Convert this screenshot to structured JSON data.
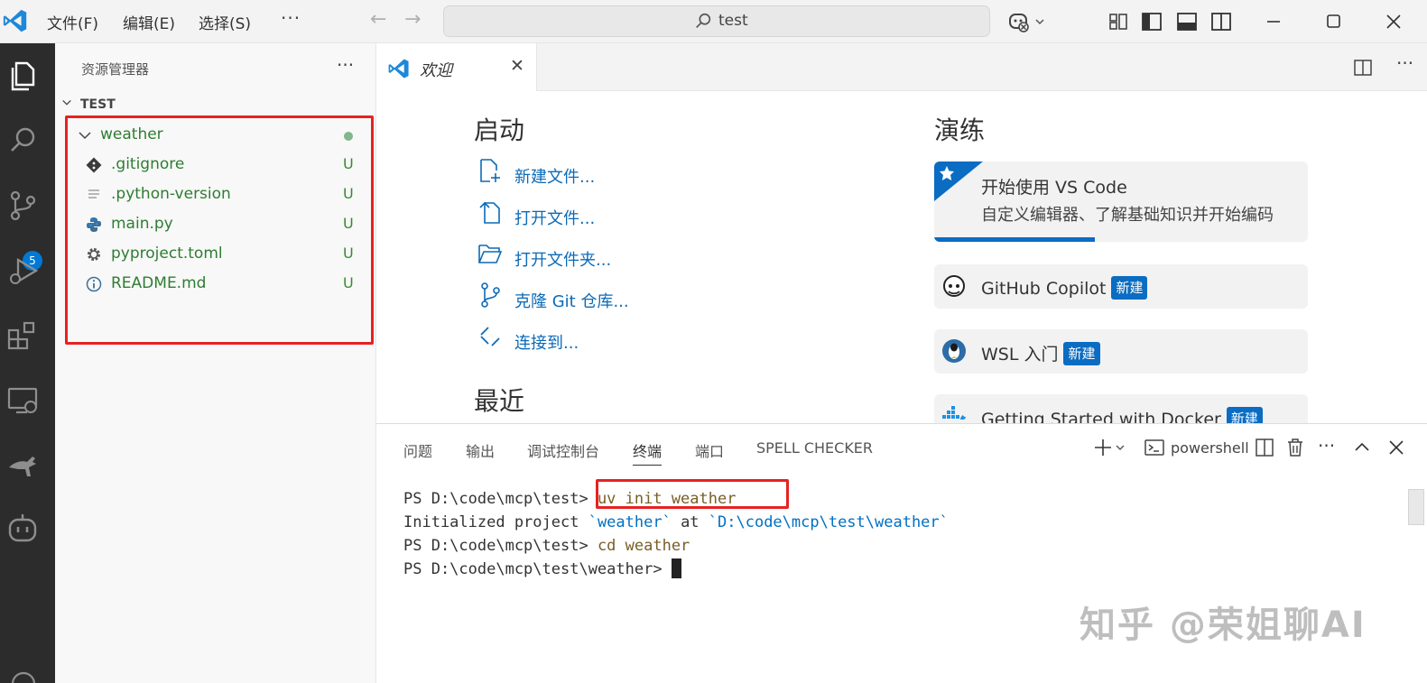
{
  "titlebar": {
    "menu": [
      "文件(F)",
      "编辑(E)",
      "选择(S)"
    ],
    "more": "···",
    "search": "test"
  },
  "activitybar": {
    "icons": [
      "explorer-icon",
      "search-icon",
      "source-control-icon",
      "run-debug-icon",
      "extensions-icon",
      "remote-explorer-icon",
      "kangaroo-icon",
      "copilot-icon"
    ],
    "source_control_badge": "5"
  },
  "sidebar": {
    "title": "资源管理器",
    "more": "···",
    "section": "TEST",
    "folder": "weather",
    "files": [
      {
        "name": ".gitignore",
        "status": "U",
        "icon": "git-icon"
      },
      {
        "name": ".python-version",
        "status": "U",
        "icon": "text-file-icon"
      },
      {
        "name": "main.py",
        "status": "U",
        "icon": "python-icon"
      },
      {
        "name": "pyproject.toml",
        "status": "U",
        "icon": "gear-icon"
      },
      {
        "name": "README.md",
        "status": "U",
        "icon": "info-icon"
      }
    ]
  },
  "editor": {
    "tab": {
      "label": "欢迎",
      "close": "✕"
    }
  },
  "welcome": {
    "start_heading": "启动",
    "start_items": [
      "新建文件...",
      "打开文件...",
      "打开文件夹...",
      "克隆 Git 仓库...",
      "连接到..."
    ],
    "recent_heading": "最近",
    "walkthrough_heading": "演练",
    "cards": [
      {
        "title": "开始使用 VS Code",
        "desc": "自定义编辑器、了解基础知识并开始编码",
        "badge": "",
        "progress": 0.43
      },
      {
        "title": "GitHub Copilot",
        "desc": "",
        "badge": "新建"
      },
      {
        "title": "WSL 入门",
        "desc": "",
        "badge": "新建"
      },
      {
        "title": "Getting Started with Docker",
        "desc": "",
        "badge": "新建"
      }
    ]
  },
  "panel": {
    "tabs": [
      "问题",
      "输出",
      "调试控制台",
      "终端",
      "端口",
      "SPELL CHECKER"
    ],
    "active_tab": "终端",
    "terminal_profile": "powershell",
    "lines": [
      {
        "prompt": "PS D:\\code\\mcp\\test> ",
        "cmd": "uv init weather"
      },
      {
        "p1": "Initialized project ",
        "s1": "`weather`",
        "p2": " at ",
        "s2": "`D:\\code\\mcp\\test\\weather`"
      },
      {
        "prompt": "PS D:\\code\\mcp\\test> ",
        "cmd": "cd weather"
      },
      {
        "prompt": "PS D:\\code\\mcp\\test\\weather> "
      }
    ]
  },
  "watermark": "知乎 @荣姐聊AI",
  "colors": {
    "accent": "#0078d4",
    "highlight": "#e52222",
    "untracked": "#388a34"
  }
}
